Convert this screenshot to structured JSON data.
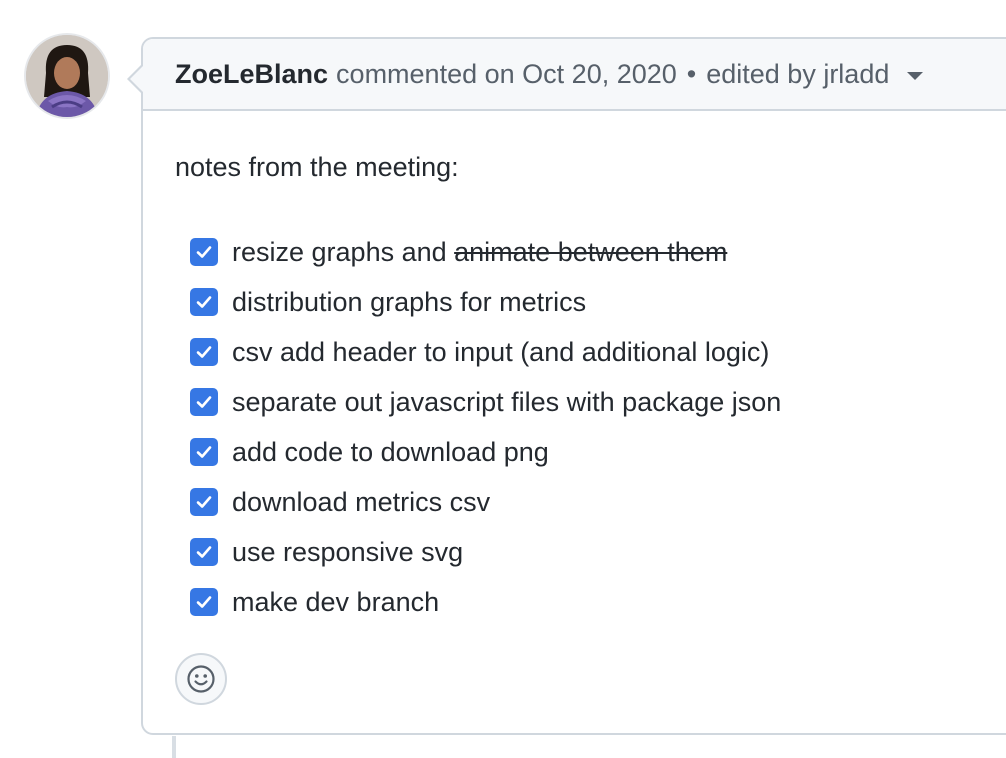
{
  "comment": {
    "author": "ZoeLeBlanc",
    "action": "commented on",
    "date": "Oct 20, 2020",
    "separator": "•",
    "edited_by": "edited by jrladd",
    "intro": "notes from the meeting:"
  },
  "tasks": [
    {
      "text": "resize graphs and ",
      "struck": "animate between them",
      "checked": true
    },
    {
      "text": "distribution graphs for metrics",
      "checked": true
    },
    {
      "text": "csv add header to input (and additional logic)",
      "checked": true
    },
    {
      "text": "separate out javascript files with package json",
      "checked": true
    },
    {
      "text": "add code to download png",
      "checked": true
    },
    {
      "text": "download metrics csv",
      "checked": true
    },
    {
      "text": "use responsive svg",
      "checked": true
    },
    {
      "text": "make dev branch",
      "checked": true
    }
  ],
  "icons": {
    "checkbox": "checkmark-icon",
    "reaction": "smiley-icon",
    "menu": "caret-down-icon"
  },
  "colors": {
    "checkbox": "#3677e4",
    "border": "#d0d7de",
    "header_bg": "#f6f8fa"
  }
}
